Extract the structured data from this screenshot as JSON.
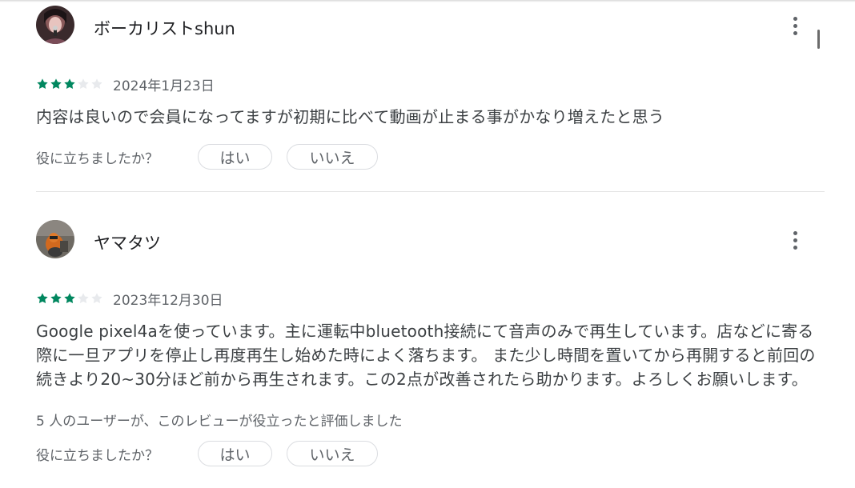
{
  "colors": {
    "star_filled": "#01875f",
    "star_empty": "#e8eaed",
    "text_primary": "#202124",
    "text_secondary": "#5f6368"
  },
  "reviews": [
    {
      "reviewer_name": "ボーカリストshun",
      "rating": 3,
      "max_rating": 5,
      "date": "2024年1月23日",
      "body": "内容は良いので会員になってますが初期に比べて動画が止まる事がかなり増えたと思う",
      "helpful_question": "役に立ちましたか？",
      "yes_label": "はい",
      "no_label": "いいえ",
      "more_icon": "more-vert-icon"
    },
    {
      "reviewer_name": "ヤマタツ",
      "rating": 3,
      "max_rating": 5,
      "date": "2023年12月30日",
      "body": "Google pixel4aを使っています。主に運転中bluetooth接続にて音声のみで再生しています。店などに寄る際に一旦アプリを停止し再度再生し始めた時によく落ちます。 また少し時間を置いてから再開すると前回の続きより20~30分ほど前から再生されます。この2点が改善されたら助かります。よろしくお願いします。",
      "helpful_count_text": "5 人のユーザーが、このレビューが役立ったと評価しました",
      "helpful_question": "役に立ちましたか？",
      "yes_label": "はい",
      "no_label": "いいえ",
      "more_icon": "more-vert-icon"
    }
  ]
}
